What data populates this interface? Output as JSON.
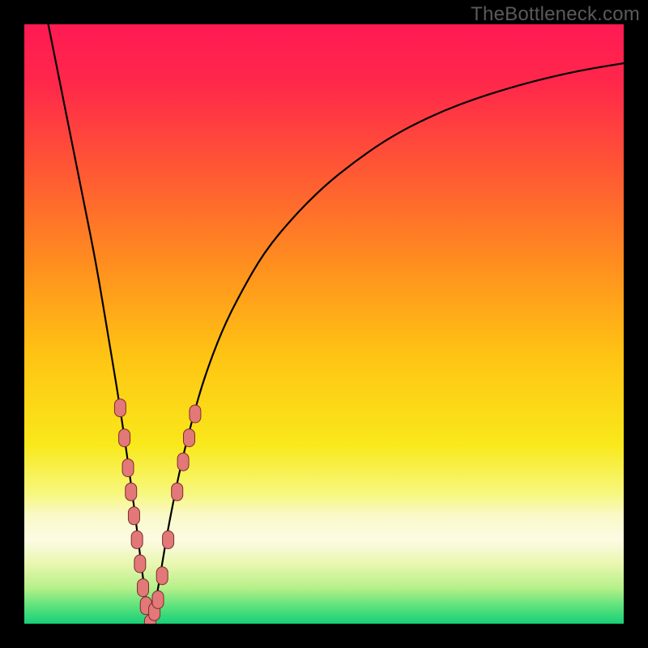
{
  "attribution": "TheBottleneck.com",
  "colors": {
    "frame": "#000000",
    "gradient_stops": [
      {
        "offset": 0.0,
        "color": "#ff1a53"
      },
      {
        "offset": 0.1,
        "color": "#ff284a"
      },
      {
        "offset": 0.25,
        "color": "#ff5a33"
      },
      {
        "offset": 0.4,
        "color": "#ff8e1f"
      },
      {
        "offset": 0.55,
        "color": "#ffc313"
      },
      {
        "offset": 0.7,
        "color": "#f9e81a"
      },
      {
        "offset": 0.78,
        "color": "#f7f77a"
      },
      {
        "offset": 0.82,
        "color": "#f9f9c9"
      },
      {
        "offset": 0.86,
        "color": "#fcfbe3"
      },
      {
        "offset": 0.9,
        "color": "#e9f7b0"
      },
      {
        "offset": 0.94,
        "color": "#b7f08a"
      },
      {
        "offset": 0.97,
        "color": "#5fe37c"
      },
      {
        "offset": 1.0,
        "color": "#17cf78"
      }
    ],
    "curve": "#000000",
    "marker_fill": "#e27878",
    "marker_stroke": "#7a2e2e"
  },
  "chart_data": {
    "type": "line",
    "title": "",
    "xlabel": "",
    "ylabel": "",
    "xlim": [
      0,
      100
    ],
    "ylim": [
      0,
      100
    ],
    "x_min_at": 21,
    "series": [
      {
        "name": "bottleneck-curve",
        "x": [
          4,
          6,
          8,
          10,
          12,
          14,
          16,
          18,
          19,
          20,
          21,
          22,
          23,
          24,
          26,
          28,
          30,
          33,
          36,
          40,
          45,
          50,
          55,
          60,
          65,
          70,
          75,
          80,
          85,
          90,
          95,
          100
        ],
        "values": [
          100,
          90,
          80,
          70,
          60,
          48,
          36,
          22,
          14,
          6,
          0,
          4,
          10,
          16,
          26,
          34,
          41,
          49,
          55,
          62,
          68,
          73,
          77,
          80.5,
          83.3,
          85.6,
          87.5,
          89.1,
          90.5,
          91.7,
          92.7,
          93.5
        ]
      }
    ],
    "markers": [
      {
        "x": 16.0,
        "y": 36
      },
      {
        "x": 16.7,
        "y": 31
      },
      {
        "x": 17.3,
        "y": 26
      },
      {
        "x": 17.8,
        "y": 22
      },
      {
        "x": 18.3,
        "y": 18
      },
      {
        "x": 18.8,
        "y": 14
      },
      {
        "x": 19.3,
        "y": 10
      },
      {
        "x": 19.8,
        "y": 6
      },
      {
        "x": 20.3,
        "y": 3
      },
      {
        "x": 21.0,
        "y": 0
      },
      {
        "x": 21.7,
        "y": 2
      },
      {
        "x": 22.3,
        "y": 4
      },
      {
        "x": 23.0,
        "y": 8
      },
      {
        "x": 24.0,
        "y": 14
      },
      {
        "x": 25.5,
        "y": 22
      },
      {
        "x": 26.5,
        "y": 27
      },
      {
        "x": 27.5,
        "y": 31
      },
      {
        "x": 28.5,
        "y": 35
      }
    ]
  }
}
